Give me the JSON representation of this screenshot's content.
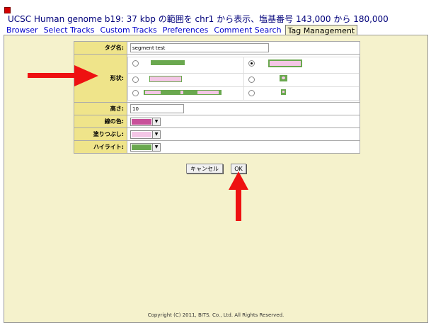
{
  "header": {
    "title": "UCSC Human genome b19: 37 kbp の範囲を chr1 から表示、塩基番号 143,000 から 180,000"
  },
  "tabs": [
    {
      "label": "Browser"
    },
    {
      "label": "Select Tracks"
    },
    {
      "label": "Custom Tracks"
    },
    {
      "label": "Preferences"
    },
    {
      "label": "Comment Search"
    },
    {
      "label": "Tag Management",
      "active": true
    }
  ],
  "form": {
    "tag_name_label": "タグ名:",
    "tag_name_value": "segment test",
    "shape_label": "形状:",
    "height_label": "高さ:",
    "height_value": "10",
    "line_color_label": "線の色:",
    "line_color": "#c8509a",
    "fill_label": "塗りつぶし:",
    "fill_color": "#f4c6e6",
    "highlight_label": "ハイライト:",
    "highlight_color": "#6aa84f"
  },
  "buttons": {
    "cancel": "キャンセル",
    "ok": "OK"
  },
  "footer": {
    "copyright": "Copyright (C) 2011, BITS. Co., Ltd. All Rights Reserved."
  },
  "colors": {
    "green": "#6aa84f",
    "pink": "#f4c6e6",
    "panel_bg": "#f5f2cc",
    "label_bg": "#efe48a",
    "arrow": "#ee1111"
  }
}
